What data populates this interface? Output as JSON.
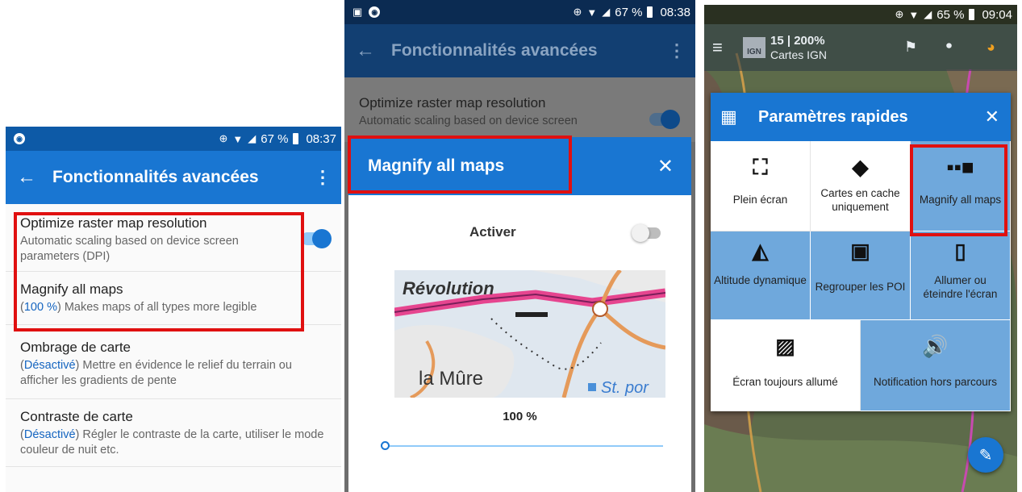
{
  "panel1": {
    "status": {
      "battery": "67 %",
      "time": "08:37"
    },
    "appbar": {
      "title": "Fonctionnalités avancées"
    },
    "settings": [
      {
        "title": "Optimize raster map resolution",
        "desc": "Automatic scaling based on device screen parameters (DPI)"
      },
      {
        "title": "Magnify all maps",
        "value": "100 %",
        "desc": "Makes maps of all types more legible"
      },
      {
        "title": "Ombrage de carte",
        "value": "Désactivé",
        "desc": "Mettre en évidence le relief du terrain ou afficher les gradients de pente"
      },
      {
        "title": "Contraste de carte",
        "value": "Désactivé",
        "desc": "Régler le contraste de la carte, utiliser le mode couleur de nuit etc."
      }
    ]
  },
  "panel2": {
    "status": {
      "battery": "67 %",
      "time": "08:38"
    },
    "appbar": {
      "title": "Fonctionnalités avancées"
    },
    "background_setting": {
      "title": "Optimize raster map resolution",
      "desc": "Automatic scaling based on device screen"
    },
    "dialog": {
      "title": "Magnify all maps",
      "toggle_label": "Activer",
      "percent": "100 %",
      "map_labels": {
        "place1": "Révolution",
        "place2": "la Mûre",
        "place3": "St. por"
      }
    }
  },
  "panel3": {
    "status": {
      "battery": "65 %",
      "time": "09:04"
    },
    "topbar": {
      "zoom": "15 | 200%",
      "layer": "Cartes IGN",
      "logo": "IGN"
    },
    "quick_settings": {
      "title": "Paramètres rapides",
      "tiles": [
        {
          "label": "Plein écran",
          "icon": "fullscreen-icon",
          "active": false
        },
        {
          "label": "Cartes en cache uniquement",
          "icon": "cache-icon",
          "active": false
        },
        {
          "label": "Magnify all maps",
          "icon": "magnify-maps-icon",
          "active": true
        },
        {
          "label": "Altitude dynamique",
          "icon": "altitude-icon",
          "active": true
        },
        {
          "label": "Regrouper les POI",
          "icon": "poi-cluster-icon",
          "active": true
        },
        {
          "label": "Allumer ou éteindre l'écran",
          "icon": "screen-toggle-icon",
          "active": true
        },
        {
          "label": "Écran toujours allumé",
          "icon": "screen-always-on-icon",
          "active": false
        },
        {
          "label": "Notification hors parcours",
          "icon": "off-route-notification-icon",
          "active": true
        }
      ]
    }
  },
  "colors": {
    "primary": "#1976d2",
    "statusbar_p1": "#0d5aa7",
    "appbar_p1": "#1976d2",
    "highlight_red": "#e01010",
    "tile_active": "#6fa8dc"
  }
}
